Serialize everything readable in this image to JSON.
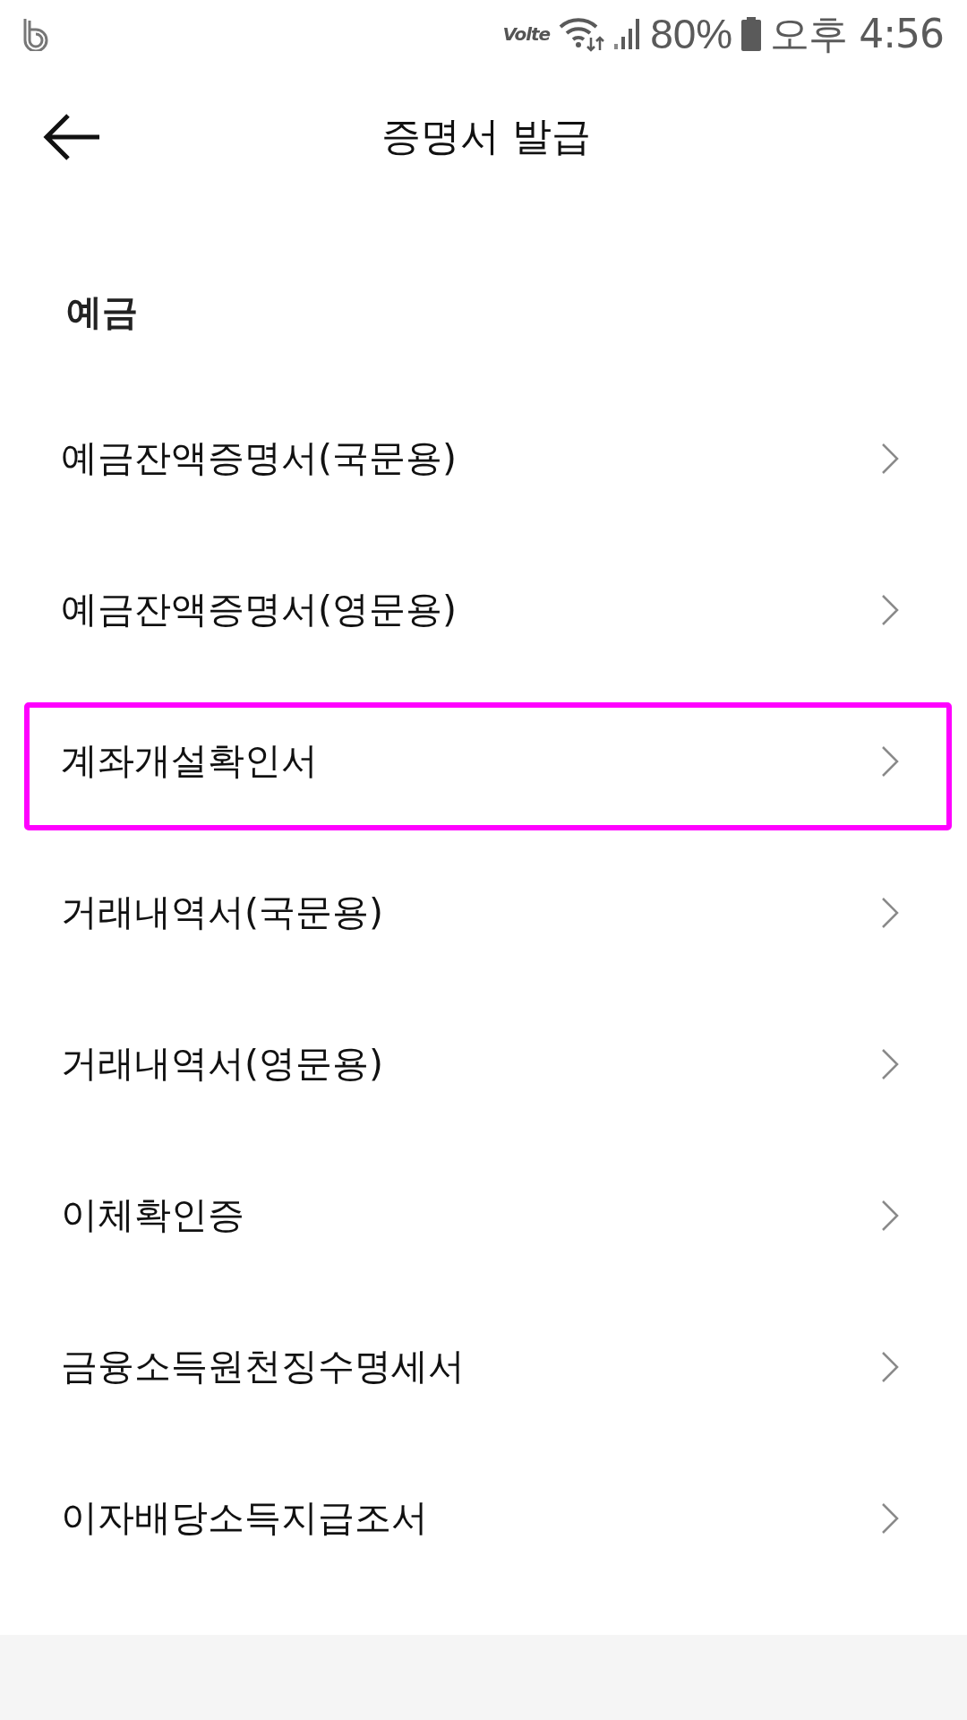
{
  "status_bar": {
    "network": "Volte",
    "battery": "80%",
    "time": "오후 4:56"
  },
  "header": {
    "title": "증명서 발급"
  },
  "section": {
    "title": "예금"
  },
  "items": [
    {
      "label": "예금잔액증명서(국문용)",
      "highlighted": false
    },
    {
      "label": "예금잔액증명서(영문용)",
      "highlighted": false
    },
    {
      "label": "계좌개설확인서",
      "highlighted": true
    },
    {
      "label": "거래내역서(국문용)",
      "highlighted": false
    },
    {
      "label": "거래내역서(영문용)",
      "highlighted": false
    },
    {
      "label": "이체확인증",
      "highlighted": false
    },
    {
      "label": "금융소득원천징수명세서",
      "highlighted": false
    },
    {
      "label": "이자배당소득지급조서",
      "highlighted": false
    }
  ]
}
